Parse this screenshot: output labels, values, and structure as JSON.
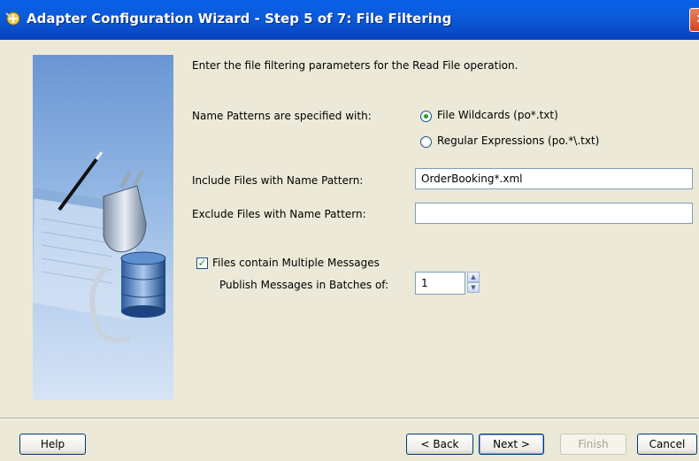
{
  "window": {
    "title": "Adapter Configuration Wizard - Step 5 of 7: File Filtering",
    "close_glyph": "✕"
  },
  "instructions": "Enter the file filtering parameters for the Read File operation.",
  "name_patterns": {
    "label": "Name Patterns are specified with:",
    "options": [
      {
        "label": "File Wildcards (po*.txt)",
        "selected": true
      },
      {
        "label": "Regular Expressions (po.*\\.txt)",
        "selected": false
      }
    ]
  },
  "include": {
    "label": "Include Files with Name Pattern:",
    "value": "OrderBooking*.xml"
  },
  "exclude": {
    "label": "Exclude Files with Name Pattern:",
    "value": ""
  },
  "multiple_messages": {
    "label": "Files contain Multiple Messages",
    "checked": true,
    "check_glyph": "✓"
  },
  "batch": {
    "label": "Publish Messages in Batches of:",
    "value": "1",
    "up_glyph": "▲",
    "down_glyph": "▼"
  },
  "buttons": {
    "help": "Help",
    "back": "< Back",
    "next": "Next >",
    "finish": "Finish",
    "cancel": "Cancel"
  },
  "icons": {
    "title": "adapter-wizard-icon",
    "side": "plug-database-illustration"
  },
  "colors": {
    "titlebar": "#0B5CDB",
    "background": "#ECE9D8",
    "check_green": "#21A121"
  }
}
